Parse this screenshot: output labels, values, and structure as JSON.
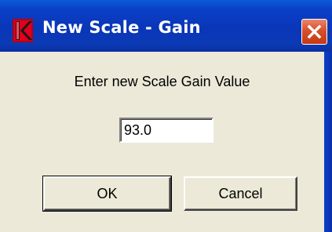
{
  "window": {
    "title": "New Scale - Gain",
    "app_icon": "k-logo-icon",
    "close_icon": "close-icon"
  },
  "dialog": {
    "prompt": "Enter new Scale Gain Value",
    "gain_value": "93.0",
    "ok_label": "OK",
    "cancel_label": "Cancel"
  },
  "colors": {
    "titlebar": "#0a3fc6",
    "client_background": "#ece9d8",
    "close_button": "#d8502a",
    "app_icon_red": "#e0001b"
  }
}
